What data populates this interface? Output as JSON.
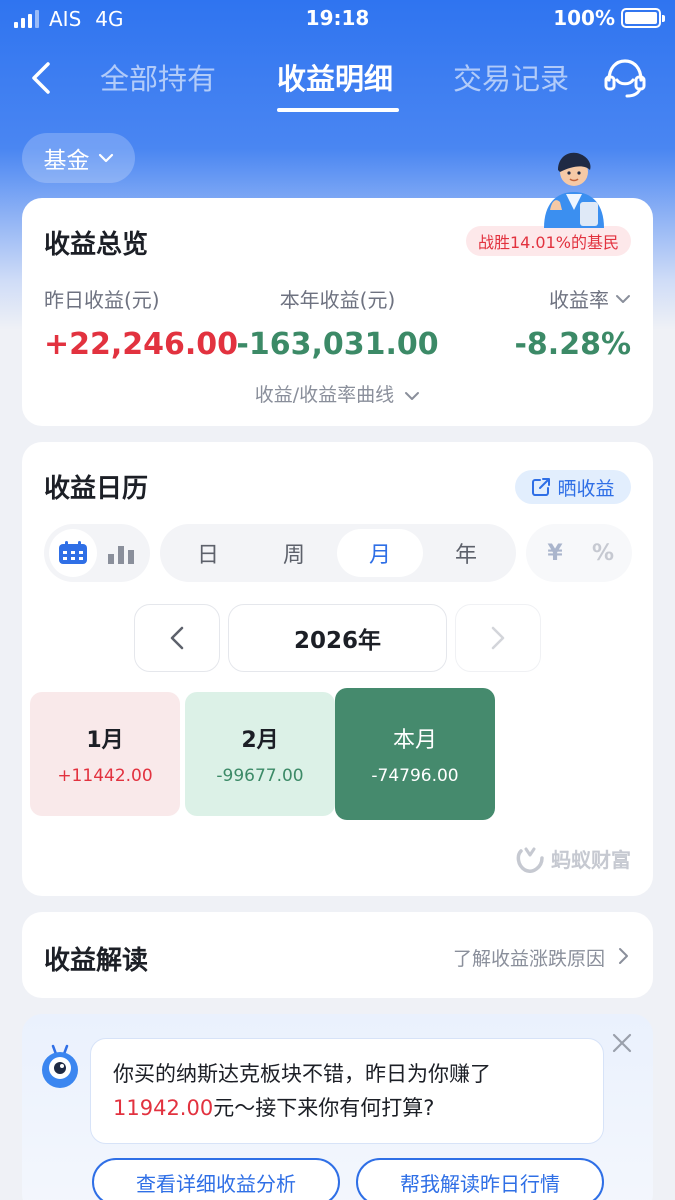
{
  "status_bar": {
    "carrier": "AIS",
    "network": "4G",
    "time": "19:18",
    "battery": "100%"
  },
  "nav": {
    "tabs": [
      {
        "label": "全部持有",
        "active": false
      },
      {
        "label": "收益明细",
        "active": true
      },
      {
        "label": "交易记录",
        "active": false
      }
    ]
  },
  "filter": {
    "label": "基金"
  },
  "overview": {
    "title": "收益总览",
    "badge": "战胜14.01%的基民",
    "yesterday": {
      "label": "昨日收益(元)",
      "value": "+22,246.00"
    },
    "this_year": {
      "label": "本年收益(元)",
      "value": "-163,031.00"
    },
    "rate": {
      "label": "收益率",
      "value": "-8.28%"
    },
    "curve_link": "收益/收益率曲线"
  },
  "calendar": {
    "title": "收益日历",
    "share": "晒收益",
    "periods": [
      "日",
      "周",
      "月",
      "年"
    ],
    "active_period": "月",
    "units": [
      "¥",
      "%"
    ],
    "year": "2026年",
    "months": [
      {
        "name": "1月",
        "value": "+11442.00"
      },
      {
        "name": "2月",
        "value": "-99677.00"
      },
      {
        "name": "本月",
        "value": "-74796.00"
      }
    ],
    "watermark": "蚂蚁财富"
  },
  "interpretation": {
    "title": "收益解读",
    "link": "了解收益涨跌原因"
  },
  "ai": {
    "message_line1": "你买的纳斯达克板块不错，昨日为你赚了",
    "amount": "11942.00",
    "message_line2": "元～接下来你有何打算?",
    "buttons": [
      "查看详细收益分析",
      "帮我解读昨日行情"
    ]
  },
  "colors": {
    "brand": "#2f74f0",
    "gain": "#e2323f",
    "loss": "#3c8a67"
  }
}
